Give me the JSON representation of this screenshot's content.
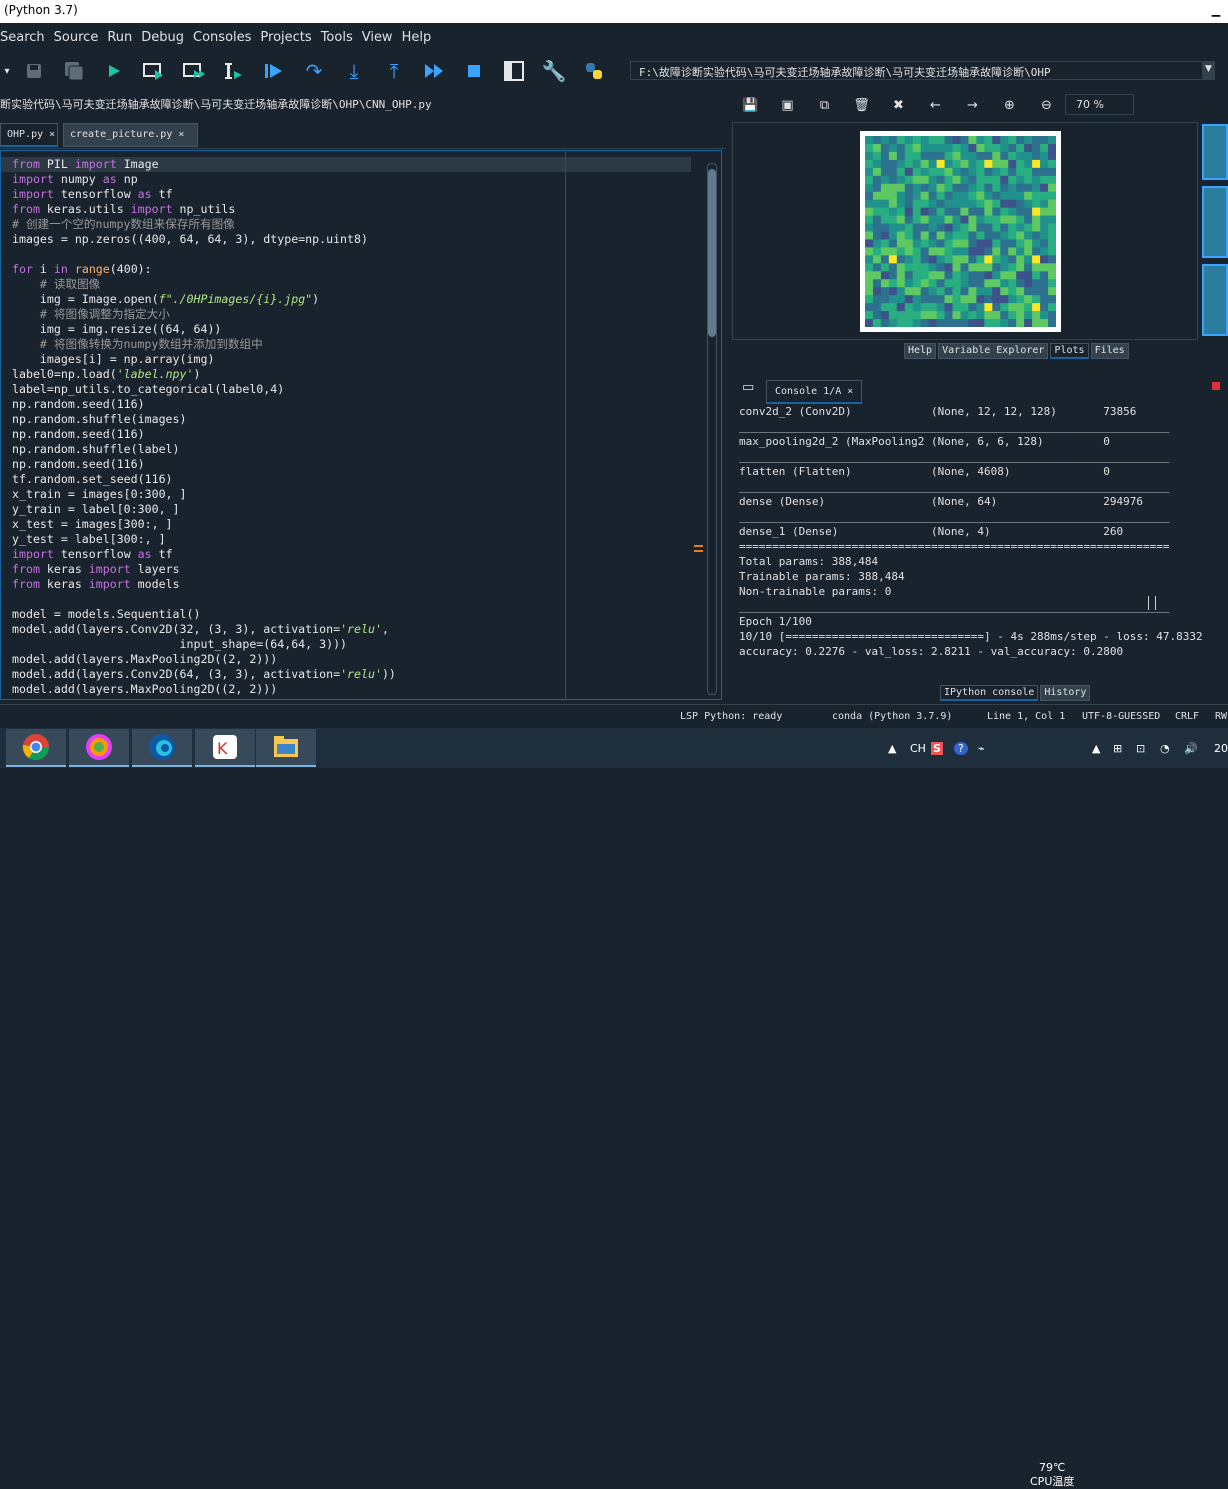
{
  "window": {
    "title": "(Python 3.7)"
  },
  "menu": [
    "Search",
    "Source",
    "Run",
    "Debug",
    "Consoles",
    "Projects",
    "Tools",
    "View",
    "Help"
  ],
  "toolbar": {
    "icons": [
      "save-icon",
      "save-all-icon",
      "run-icon",
      "run-cell-icon",
      "run-cell-advance-icon",
      "run-selection-icon",
      "debug-icon",
      "step-icon",
      "step-into-icon",
      "step-return-icon",
      "continue-icon",
      "stop-icon",
      "maximize-pane-icon",
      "preferences-icon",
      "python-path-icon"
    ],
    "path": "F:\\故障诊断实验代码\\马可夫变迁场轴承故障诊断\\马可夫变迁场轴承故障诊断\\OHP",
    "dropdown": "▼"
  },
  "editor": {
    "filepath": "断实验代码\\马可夫变迁场轴承故障诊断\\马可夫变迁场轴承故障诊断\\OHP\\CNN_OHP.py",
    "tabs": [
      {
        "label": "OHP.py ×",
        "active": true
      },
      {
        "label": "create_picture.py ×",
        "active": false
      }
    ],
    "menu": "☰"
  },
  "plots": {
    "zoom": "70 %",
    "tabs": [
      "Help",
      "Variable Explorer",
      "Plots",
      "Files"
    ],
    "active_tab": "Plots"
  },
  "console": {
    "tab": "Console 1/A ×",
    "lines": [
      "conv2d_2 (Conv2D)            (None, 12, 12, 128)       73856",
      "_________________________________________________________________",
      "max_pooling2d_2 (MaxPooling2 (None, 6, 6, 128)         0",
      "_________________________________________________________________",
      "flatten (Flatten)            (None, 4608)              0",
      "_________________________________________________________________",
      "dense (Dense)                (None, 64)                294976",
      "_________________________________________________________________",
      "dense_1 (Dense)              (None, 4)                 260",
      "=================================================================",
      "Total params: 388,484",
      "Trainable params: 388,484",
      "Non-trainable params: 0",
      "_________________________________________________________________",
      "Epoch 1/100",
      "10/10 [==============================] - 4s 288ms/step - loss: 47.8332",
      "accuracy: 0.2276 - val_loss: 2.8211 - val_accuracy: 0.2800"
    ],
    "bottom_tabs": [
      "IPython console",
      "History"
    ],
    "active_bottom_tab": "IPython console"
  },
  "status": {
    "lsp": "LSP Python: ready",
    "conda": "conda (Python 3.7.9)",
    "position": "Line 1, Col 1",
    "encoding": "UTF-8-GUESSED",
    "eol": "CRLF",
    "rw": "RW"
  },
  "taskbar": {
    "apps": [
      "chrome-icon",
      "browser-icon",
      "edge-icon",
      "wps-icon",
      "file-explorer-icon"
    ],
    "ime": "CH",
    "temp": "79℃",
    "temp_label": "CPU温度",
    "clock": "20"
  }
}
